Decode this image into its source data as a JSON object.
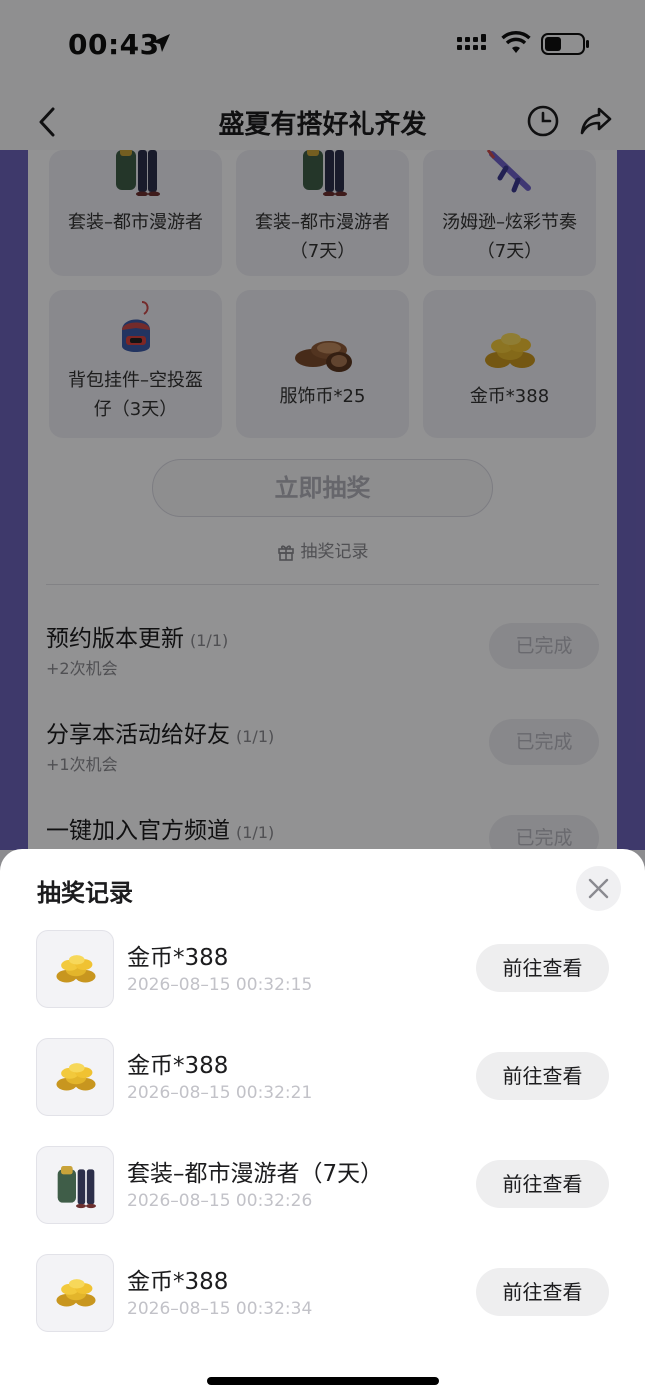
{
  "status_bar": {
    "time": "00:43"
  },
  "nav": {
    "title": "盛夏有搭好礼齐发"
  },
  "prizes": [
    {
      "label": "套装–都市漫游者",
      "icon": "outfit-icon"
    },
    {
      "label": "套装–都市漫游者（7天）",
      "icon": "outfit-icon"
    },
    {
      "label": "汤姆逊–炫彩节奏（7天）",
      "icon": "gun-icon"
    },
    {
      "label": "背包挂件–空投盔仔（3天）",
      "icon": "backpack-charm-icon"
    },
    {
      "label": "服饰币*25",
      "icon": "costume-coin-icon"
    },
    {
      "label": "金币*388",
      "icon": "gold-coin-icon"
    }
  ],
  "draw_button": "立即抽奖",
  "record_link": "抽奖记录",
  "tasks": [
    {
      "title": "预约版本更新",
      "count": "(1/1)",
      "sub": "+2次机会",
      "status": "已完成"
    },
    {
      "title": "分享本活动给好友",
      "count": "(1/1)",
      "sub": "+1次机会",
      "status": "已完成"
    },
    {
      "title": "一键加入官方频道",
      "count": "(1/1)",
      "sub": "",
      "status": "已完成"
    }
  ],
  "sheet": {
    "title": "抽奖记录",
    "records": [
      {
        "name": "金币*388",
        "time": "2026–08–15 00:32:15",
        "button": "前往查看",
        "icon": "gold-coin-icon"
      },
      {
        "name": "金币*388",
        "time": "2026–08–15 00:32:21",
        "button": "前往查看",
        "icon": "gold-coin-icon"
      },
      {
        "name": "套装–都市漫游者（7天）",
        "time": "2026–08–15 00:32:26",
        "button": "前往查看",
        "icon": "outfit-icon"
      },
      {
        "name": "金币*388",
        "time": "2026–08–15 00:32:34",
        "button": "前往查看",
        "icon": "gold-coin-icon"
      }
    ]
  },
  "colors": {
    "accent_band": "#6c63b8",
    "sheet_bg": "#ffffff",
    "button_bg": "#eeeeef"
  }
}
